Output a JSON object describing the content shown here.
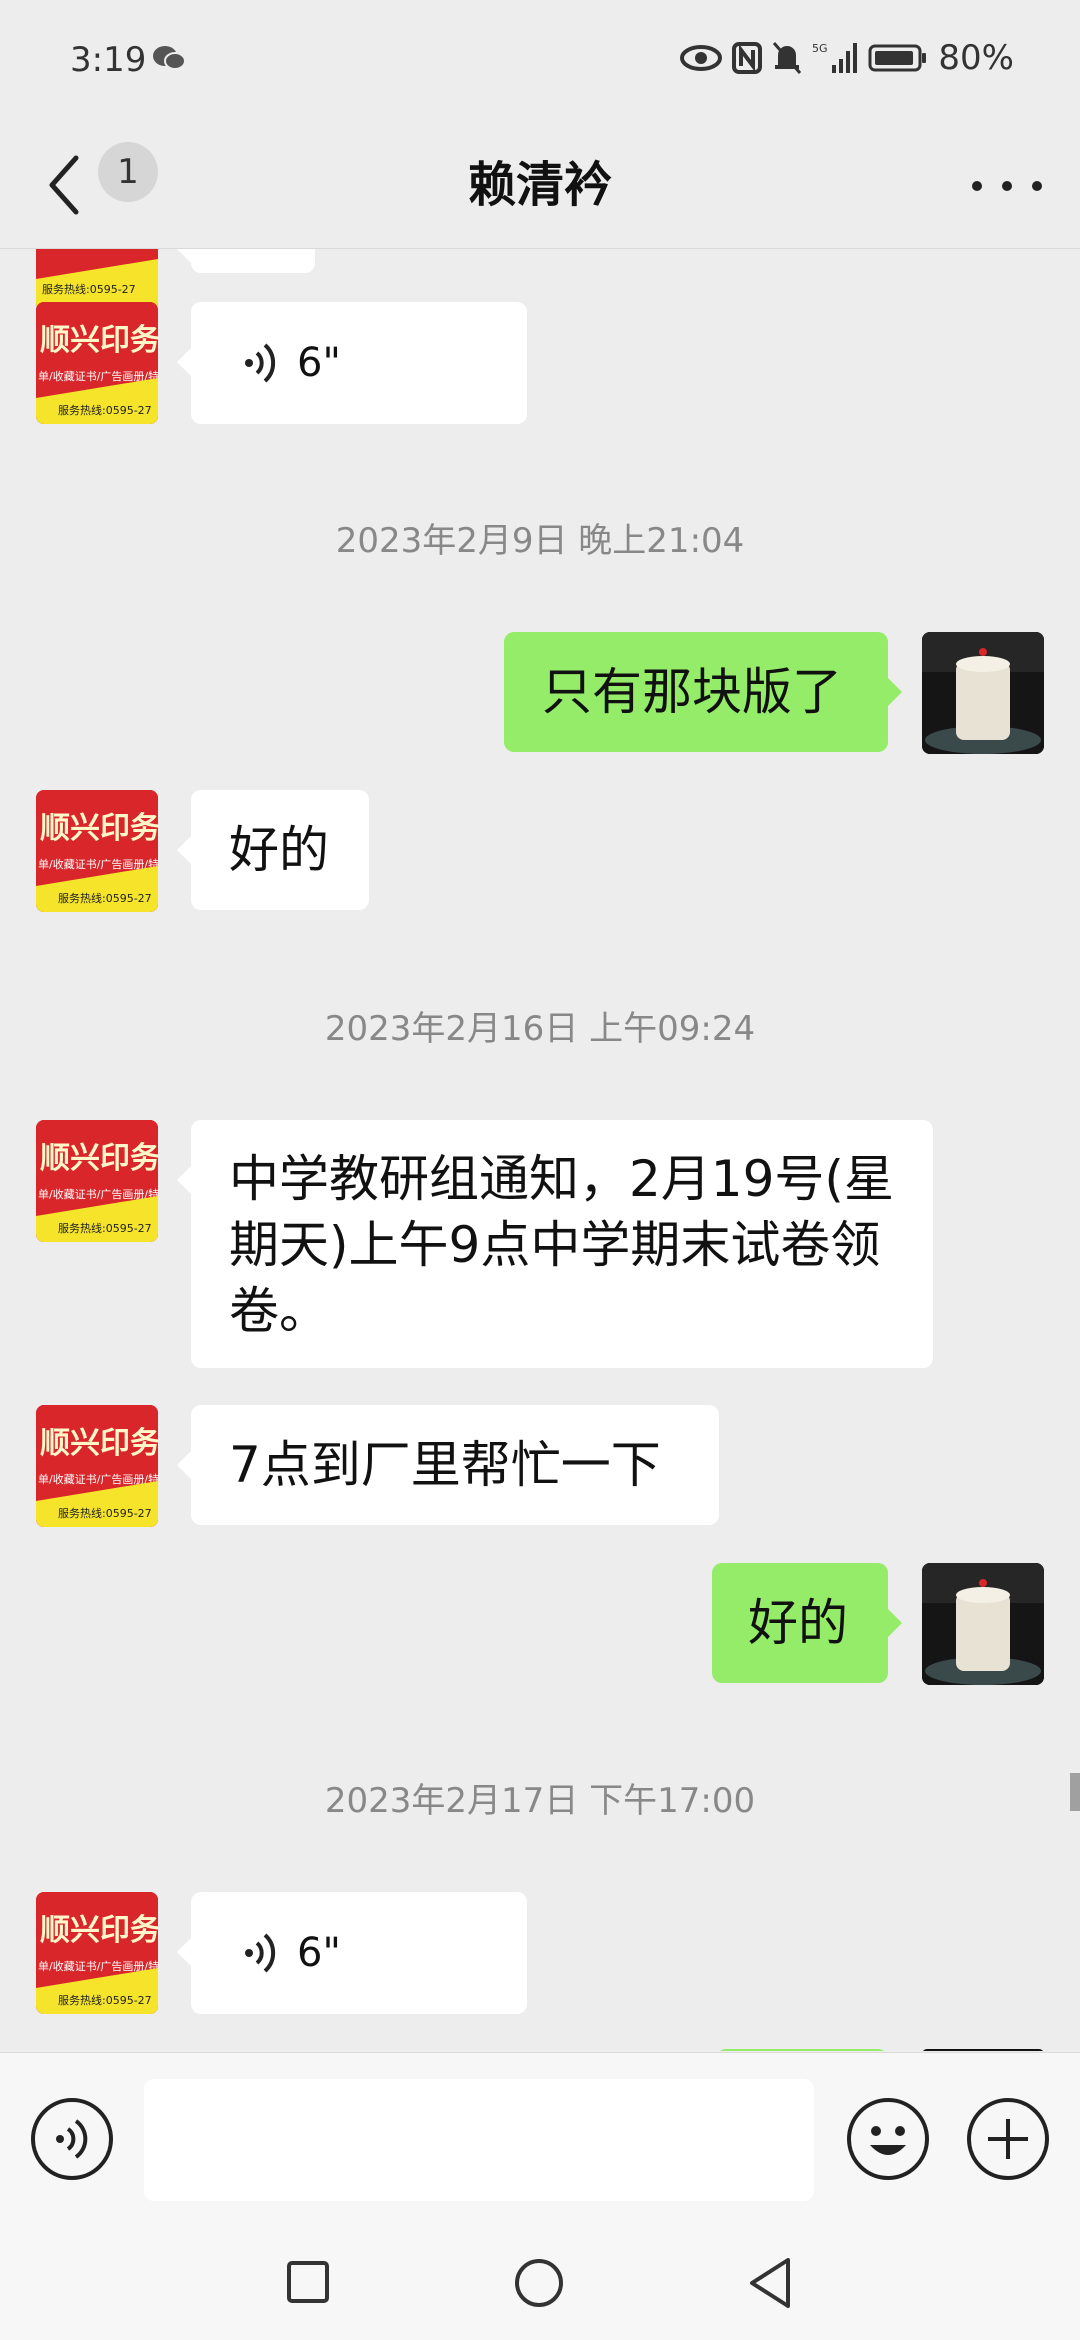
{
  "status_bar": {
    "time": "3:19",
    "network": "5G",
    "battery": "80%"
  },
  "header": {
    "unread_count": "1",
    "title": "赖清衿"
  },
  "avatar_text": {
    "shop_name": "顺兴印务",
    "shop_sub": "单/收藏证书/广告画册/特",
    "shop_phone": "服务热线:0595-27"
  },
  "messages": [
    {
      "type": "voice",
      "side": "in",
      "duration": "6\""
    },
    {
      "type": "timestamp",
      "text": "2023年2月9日 晚上21:04"
    },
    {
      "type": "text",
      "side": "out",
      "text": "只有那块版了"
    },
    {
      "type": "text",
      "side": "in",
      "text": "好的"
    },
    {
      "type": "timestamp",
      "text": "2023年2月16日 上午09:24"
    },
    {
      "type": "text",
      "side": "in",
      "text": "中学教研组通知，2月19号(星期天)上午9点中学期末试卷领卷。"
    },
    {
      "type": "text",
      "side": "in",
      "text": "7点到厂里帮忙一下"
    },
    {
      "type": "text",
      "side": "out",
      "text": "好的"
    },
    {
      "type": "timestamp",
      "text": "2023年2月17日 下午17:00"
    },
    {
      "type": "voice",
      "side": "in",
      "duration": "6\""
    }
  ],
  "colors": {
    "outgoing_bubble": "#95ec69",
    "incoming_bubble": "#ffffff",
    "background": "#ededed"
  }
}
